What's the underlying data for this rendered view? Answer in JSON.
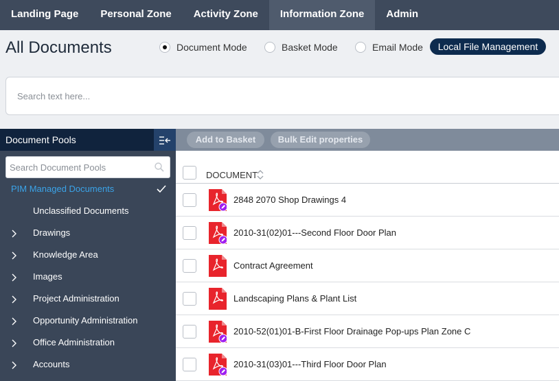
{
  "nav": {
    "items": [
      {
        "label": "Landing Page",
        "active": false
      },
      {
        "label": "Personal Zone",
        "active": false
      },
      {
        "label": "Activity Zone",
        "active": false
      },
      {
        "label": "Information Zone",
        "active": true
      },
      {
        "label": "Admin",
        "active": false
      }
    ]
  },
  "page": {
    "title": "All Documents"
  },
  "modes": [
    {
      "label": "Document Mode",
      "selected": true
    },
    {
      "label": "Basket Mode",
      "selected": false
    },
    {
      "label": "Email Mode",
      "selected": false
    }
  ],
  "local_file_management_label": "Local File Management",
  "search": {
    "placeholder": "Search text here..."
  },
  "sidebar": {
    "title": "Document Pools",
    "search_placeholder": "Search Document Pools",
    "items": [
      {
        "label": "PIM Managed Documents",
        "selected": true,
        "expandable": false
      },
      {
        "label": "Unclassified Documents",
        "selected": false,
        "expandable": false
      },
      {
        "label": "Drawings",
        "selected": false,
        "expandable": true
      },
      {
        "label": "Knowledge Area",
        "selected": false,
        "expandable": true
      },
      {
        "label": "Images",
        "selected": false,
        "expandable": true
      },
      {
        "label": "Project Administration",
        "selected": false,
        "expandable": true
      },
      {
        "label": "Opportunity Administration",
        "selected": false,
        "expandable": true
      },
      {
        "label": "Office Administration",
        "selected": false,
        "expandable": true
      },
      {
        "label": "Accounts",
        "selected": false,
        "expandable": true
      }
    ]
  },
  "toolbar": {
    "add_to_basket": "Add to Basket",
    "bulk_edit": "Bulk Edit properties"
  },
  "table": {
    "column_document": "DOCUMENT",
    "rows": [
      {
        "name": "2848 2070 Shop Drawings 4",
        "signed": true
      },
      {
        "name": "2010-31(02)01---Second Floor Door Plan",
        "signed": true
      },
      {
        "name": "Contract Agreement",
        "signed": false
      },
      {
        "name": "Landscaping Plans & Plant List",
        "signed": false
      },
      {
        "name": "2010-52(01)01-B-First Floor Drainage Pop-ups Plan Zone C",
        "signed": true
      },
      {
        "name": "2010-31(03)01---Third Floor Door Plan",
        "signed": true
      }
    ]
  },
  "colors": {
    "nav_bg": "#3e4a5c",
    "sidebar_bg": "#3a4658",
    "accent_selected": "#3aa3e8",
    "pdf_red": "#e8242c",
    "edit_badge": "#a020f0",
    "primary_button": "#0d2b4e"
  },
  "icons": {
    "collapse": "collapse-sidebar-icon",
    "search": "search-icon",
    "check": "checkmark-icon",
    "chevron": "chevron-right-icon",
    "sort": "sort-icon",
    "pdf": "pdf-file-icon",
    "edit_badge": "edit-badge-icon"
  }
}
